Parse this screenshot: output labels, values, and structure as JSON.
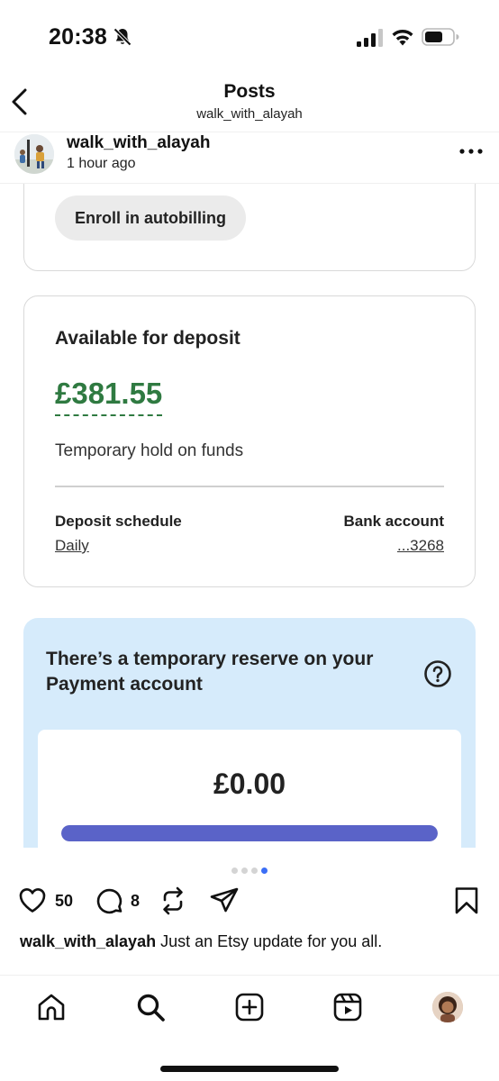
{
  "status_bar": {
    "time": "20:38",
    "icons": [
      "bell-slash-icon",
      "signal-icon",
      "wifi-icon",
      "battery-icon"
    ]
  },
  "header": {
    "title": "Posts",
    "subtitle": "walk_with_alayah",
    "back_icon": "chevron-left-icon"
  },
  "post": {
    "author": "walk_with_alayah",
    "time_ago": "1 hour ago",
    "more_icon": "more-horizontal-icon",
    "image": {
      "autobilling_button": "Enroll in autobilling",
      "deposit": {
        "title": "Available for deposit",
        "amount": "£381.55",
        "hold_note": "Temporary hold on funds",
        "schedule_label": "Deposit schedule",
        "schedule_value": "Daily",
        "bank_label": "Bank account",
        "bank_value": "...3268"
      },
      "reserve": {
        "message": "There’s a temporary reserve on your Payment account",
        "amount": "£0.00",
        "bar_fill_fraction": 1.0,
        "bar_color": "#5a63c8",
        "background_color": "#d6ebfb"
      },
      "accent_green": "#2f7a41"
    },
    "carousel": {
      "count": 4,
      "active_index": 3,
      "active_color": "#3b6ef6"
    },
    "actions": {
      "likes": "50",
      "comments": "8",
      "icons": [
        "heart-icon",
        "comment-icon",
        "repost-icon",
        "share-icon",
        "bookmark-icon"
      ]
    },
    "caption": {
      "user": "walk_with_alayah",
      "text": "Just an Etsy update for you all."
    }
  },
  "bottom_nav": {
    "items": [
      "home-icon",
      "search-icon",
      "create-icon",
      "reels-icon",
      "profile-avatar"
    ]
  }
}
